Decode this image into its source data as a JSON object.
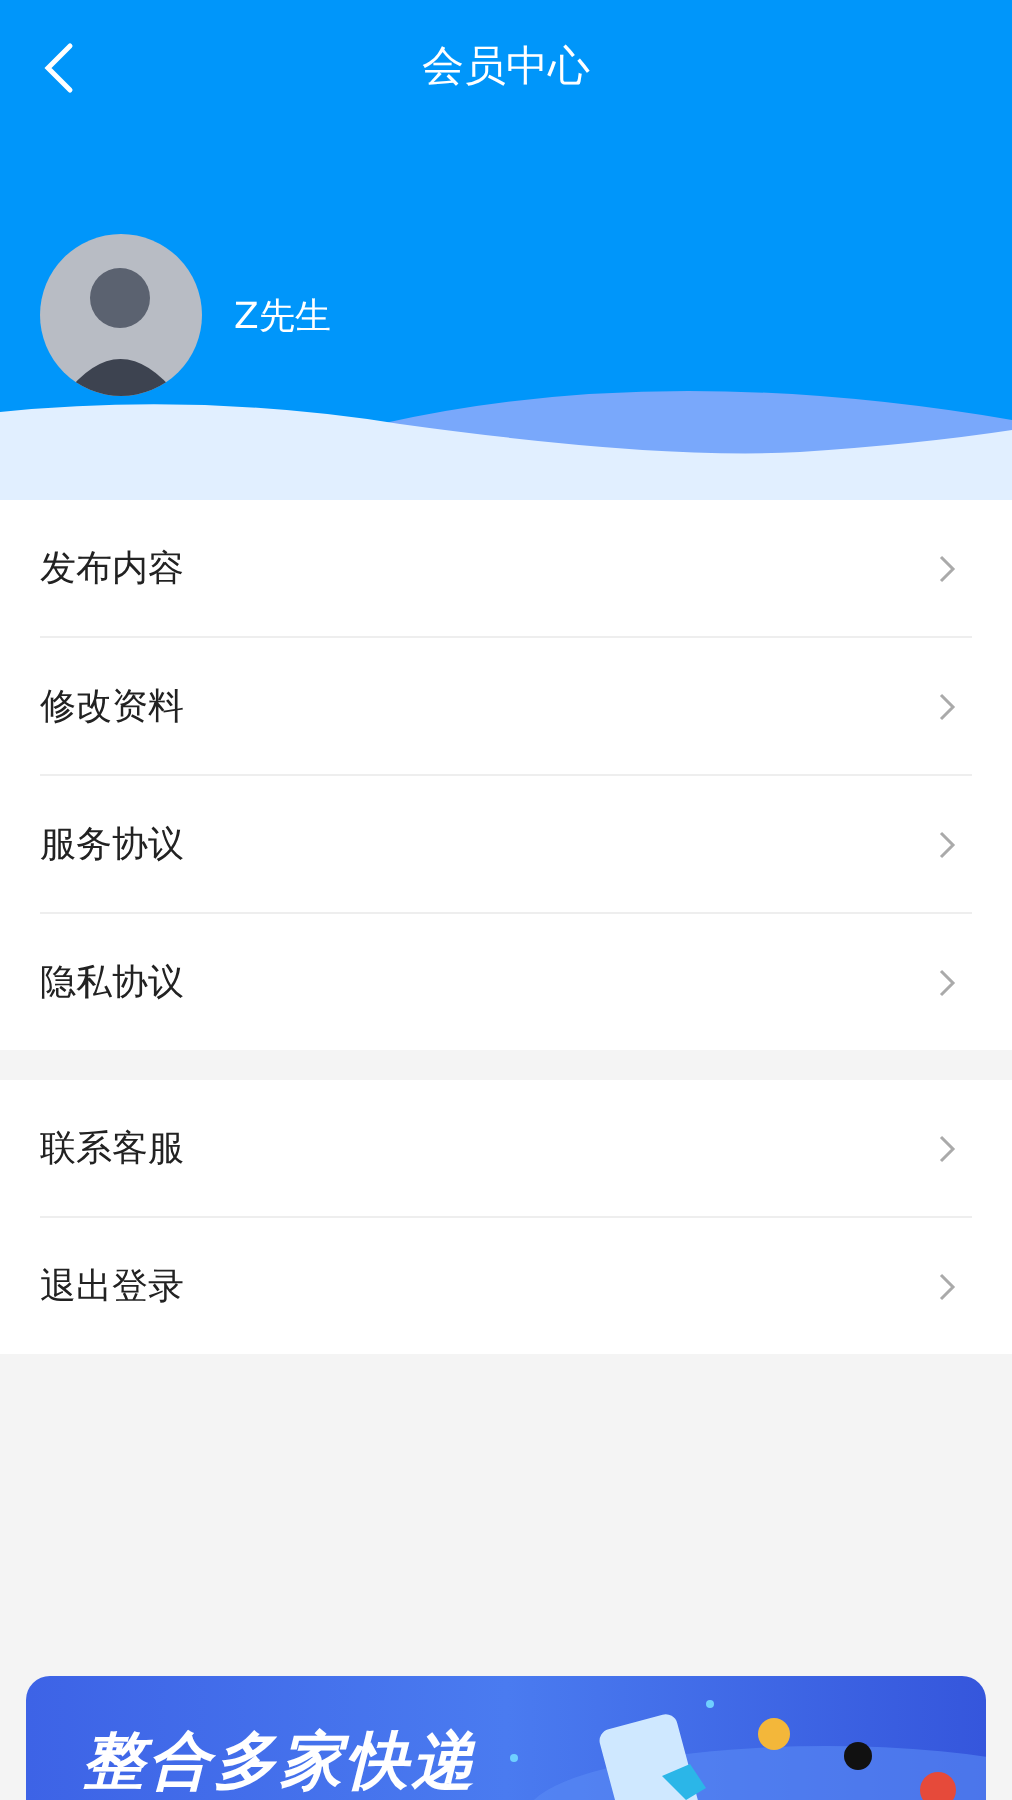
{
  "header": {
    "title": "会员中心"
  },
  "user": {
    "name": "Z先生"
  },
  "menu_groups": [
    {
      "items": [
        {
          "label": "发布内容"
        },
        {
          "label": "修改资料"
        },
        {
          "label": "服务协议"
        },
        {
          "label": "隐私协议"
        }
      ]
    },
    {
      "items": [
        {
          "label": "联系客服"
        },
        {
          "label": "退出登录"
        }
      ]
    }
  ],
  "banner": {
    "title": "整合多家快递"
  }
}
